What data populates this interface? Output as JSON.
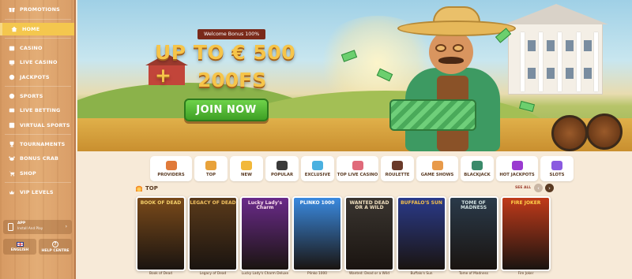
{
  "sidebar": {
    "items": [
      {
        "label": "PROMOTIONS",
        "icon": "gift-icon",
        "active": false
      },
      {
        "label": "HOME",
        "icon": "home-icon",
        "active": true
      },
      {
        "label": "CASINO",
        "icon": "slot-icon",
        "active": false
      },
      {
        "label": "LIVE CASINO",
        "icon": "live-icon",
        "active": false
      },
      {
        "label": "JACKPOTS",
        "icon": "jackpot-icon",
        "active": false
      },
      {
        "label": "SPORTS",
        "icon": "ball-icon",
        "active": false
      },
      {
        "label": "LIVE BETTING",
        "icon": "live-betting-icon",
        "active": false
      },
      {
        "label": "VIRTUAL SPORTS",
        "icon": "virtual-icon",
        "active": false
      },
      {
        "label": "TOURNAMENTS",
        "icon": "trophy-icon",
        "active": false
      },
      {
        "label": "BONUS CRAB",
        "icon": "crab-icon",
        "active": false
      },
      {
        "label": "SHOP",
        "icon": "cart-icon",
        "active": false
      },
      {
        "label": "VIP LEVELS",
        "icon": "vip-icon",
        "active": false
      }
    ],
    "app": {
      "title": "APP",
      "subtitle": "Install And Play"
    },
    "language": "ENGLISH",
    "help": "HELP CENTRE"
  },
  "banner": {
    "badge": "Welcome Bonus 100%",
    "line1": "UP TO € 500 +",
    "line2": "200FS",
    "cta": "JOIN NOW"
  },
  "categories": [
    {
      "label": "PROVIDERS",
      "color": "#e07a3a"
    },
    {
      "label": "TOP",
      "color": "#e8a23a"
    },
    {
      "label": "NEW",
      "color": "#f2b83a"
    },
    {
      "label": "POPULAR",
      "color": "#3a3a3a"
    },
    {
      "label": "EXCLUSIVE",
      "color": "#4ab0e0"
    },
    {
      "label": "TOP LIVE CASINO",
      "color": "#e06a7a"
    },
    {
      "label": "ROULETTE",
      "color": "#6a3a2a"
    },
    {
      "label": "GAME SHOWS",
      "color": "#e89a4a"
    },
    {
      "label": "BLACKJACK",
      "color": "#3a8a6a"
    },
    {
      "label": "HOT JACKPOTS",
      "color": "#9a3ad0"
    },
    {
      "label": "SLOTS",
      "color": "#8a5ae0"
    }
  ],
  "section": {
    "title": "TOP",
    "see_all": "SEE ALL"
  },
  "games": [
    {
      "name": "Book of Dead",
      "thumb_text": "BOOK OF DEAD",
      "bg": "#7a4a1a",
      "fg": "#f4d06a"
    },
    {
      "name": "Legacy of Dead",
      "thumb_text": "LEGACY OF DEAD",
      "bg": "#5a3a1a",
      "fg": "#f0c060"
    },
    {
      "name": "Lucky Lady's Charm Deluxe",
      "thumb_text": "Lucky Lady's Charm",
      "bg": "#6a2a8a",
      "fg": "#ffe0f0"
    },
    {
      "name": "Plinko 1000",
      "thumb_text": "PLINKO 1000",
      "bg": "#3a8ae0",
      "fg": "#ffffff"
    },
    {
      "name": "Wanted: Dead or a Wild",
      "thumb_text": "WANTED DEAD OR A WILD",
      "bg": "#3a3530",
      "fg": "#f0e0c0"
    },
    {
      "name": "Buffalo's Sun",
      "thumb_text": "BUFFALO'S SUN",
      "bg": "#2a3a8a",
      "fg": "#f4c04a"
    },
    {
      "name": "Tome of Madness",
      "thumb_text": "TOME OF MADNESS",
      "bg": "#2a3a4a",
      "fg": "#d0e0e0"
    },
    {
      "name": "Fire Joker",
      "thumb_text": "FIRE JOKER",
      "bg": "#c03a1a",
      "fg": "#ffd24a"
    }
  ]
}
